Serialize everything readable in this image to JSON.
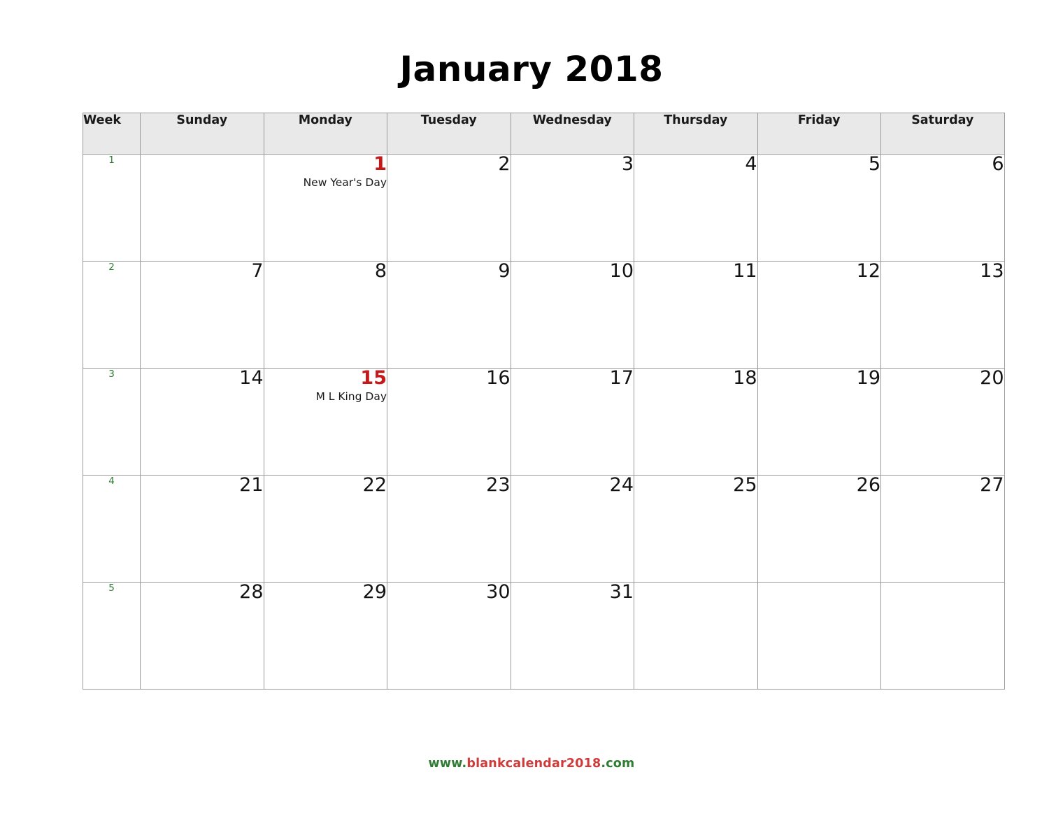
{
  "title": "January 2018",
  "colors": {
    "holiday_red": "#c41a1a",
    "week_green": "#2f7d32",
    "header_bg": "#e9e9e9",
    "grid_line": "#bdbdbd",
    "footer_green": "#2f7d32",
    "footer_red": "#cf3b3b"
  },
  "header": {
    "week_label": "Week",
    "days": [
      "Sunday",
      "Monday",
      "Tuesday",
      "Wednesday",
      "Thursday",
      "Friday",
      "Saturday"
    ]
  },
  "weeks": [
    {
      "week_number": "1",
      "cells": [
        {
          "day": "",
          "event": "",
          "holiday": false
        },
        {
          "day": "1",
          "event": "New Year's Day",
          "holiday": true
        },
        {
          "day": "2",
          "event": "",
          "holiday": false
        },
        {
          "day": "3",
          "event": "",
          "holiday": false
        },
        {
          "day": "4",
          "event": "",
          "holiday": false
        },
        {
          "day": "5",
          "event": "",
          "holiday": false
        },
        {
          "day": "6",
          "event": "",
          "holiday": false
        }
      ]
    },
    {
      "week_number": "2",
      "cells": [
        {
          "day": "7",
          "event": "",
          "holiday": false
        },
        {
          "day": "8",
          "event": "",
          "holiday": false
        },
        {
          "day": "9",
          "event": "",
          "holiday": false
        },
        {
          "day": "10",
          "event": "",
          "holiday": false
        },
        {
          "day": "11",
          "event": "",
          "holiday": false
        },
        {
          "day": "12",
          "event": "",
          "holiday": false
        },
        {
          "day": "13",
          "event": "",
          "holiday": false
        }
      ]
    },
    {
      "week_number": "3",
      "cells": [
        {
          "day": "14",
          "event": "",
          "holiday": false
        },
        {
          "day": "15",
          "event": "M L King Day",
          "holiday": true
        },
        {
          "day": "16",
          "event": "",
          "holiday": false
        },
        {
          "day": "17",
          "event": "",
          "holiday": false
        },
        {
          "day": "18",
          "event": "",
          "holiday": false
        },
        {
          "day": "19",
          "event": "",
          "holiday": false
        },
        {
          "day": "20",
          "event": "",
          "holiday": false
        }
      ]
    },
    {
      "week_number": "4",
      "cells": [
        {
          "day": "21",
          "event": "",
          "holiday": false
        },
        {
          "day": "22",
          "event": "",
          "holiday": false
        },
        {
          "day": "23",
          "event": "",
          "holiday": false
        },
        {
          "day": "24",
          "event": "",
          "holiday": false
        },
        {
          "day": "25",
          "event": "",
          "holiday": false
        },
        {
          "day": "26",
          "event": "",
          "holiday": false
        },
        {
          "day": "27",
          "event": "",
          "holiday": false
        }
      ]
    },
    {
      "week_number": "5",
      "cells": [
        {
          "day": "28",
          "event": "",
          "holiday": false
        },
        {
          "day": "29",
          "event": "",
          "holiday": false
        },
        {
          "day": "30",
          "event": "",
          "holiday": false
        },
        {
          "day": "31",
          "event": "",
          "holiday": false
        },
        {
          "day": "",
          "event": "",
          "holiday": false
        },
        {
          "day": "",
          "event": "",
          "holiday": false
        },
        {
          "day": "",
          "event": "",
          "holiday": false
        }
      ]
    }
  ],
  "footer": {
    "full_text": "www.blankcalendar2018.com",
    "segments": [
      {
        "text": "www.",
        "color": "green"
      },
      {
        "text": "blankcalendar2018",
        "color": "red"
      },
      {
        "text": ".com",
        "color": "green"
      }
    ]
  }
}
